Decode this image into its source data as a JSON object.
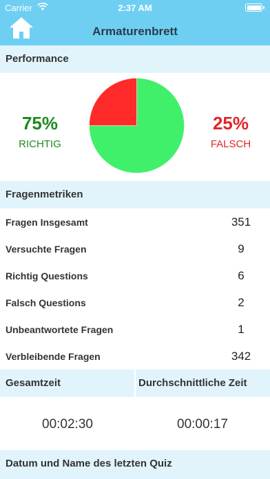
{
  "status_bar": {
    "carrier": "Carrier",
    "time": "2:37 AM"
  },
  "nav": {
    "title": "Armaturenbrett",
    "home_icon": "home-icon"
  },
  "performance": {
    "header": "Performance",
    "correct": {
      "percent": "75%",
      "label": "RICHTIG"
    },
    "wrong": {
      "percent": "25%",
      "label": "FALSCH"
    }
  },
  "chart_data": {
    "type": "pie",
    "slices": [
      {
        "label": "RICHTIG",
        "value": 75,
        "color": "#41f06a"
      },
      {
        "label": "FALSCH",
        "value": 25,
        "color": "#ff2a2a"
      }
    ]
  },
  "metrics": {
    "header": "Fragenmetriken",
    "rows": [
      {
        "label": "Fragen Insgesamt",
        "value": "351"
      },
      {
        "label": "Versuchte Fragen",
        "value": "9"
      },
      {
        "label": "Richtig Questions",
        "value": "6"
      },
      {
        "label": "Falsch Questions",
        "value": "2"
      },
      {
        "label": "Unbeantwortete Fragen",
        "value": "1"
      },
      {
        "label": "Verbleibende Fragen",
        "value": "342"
      }
    ]
  },
  "times": {
    "total_header": "Gesamtzeit",
    "avg_header": "Durchschnittliche Zeit",
    "total_value": "00:02:30",
    "avg_value": "00:00:17"
  },
  "last_quiz": {
    "header": "Datum und Name des letzten Quiz"
  },
  "colors": {
    "header_bar": "#6ecff2",
    "section_bg": "#e2f4fb",
    "correct": "#1f8a1f",
    "wrong": "#e02525"
  }
}
